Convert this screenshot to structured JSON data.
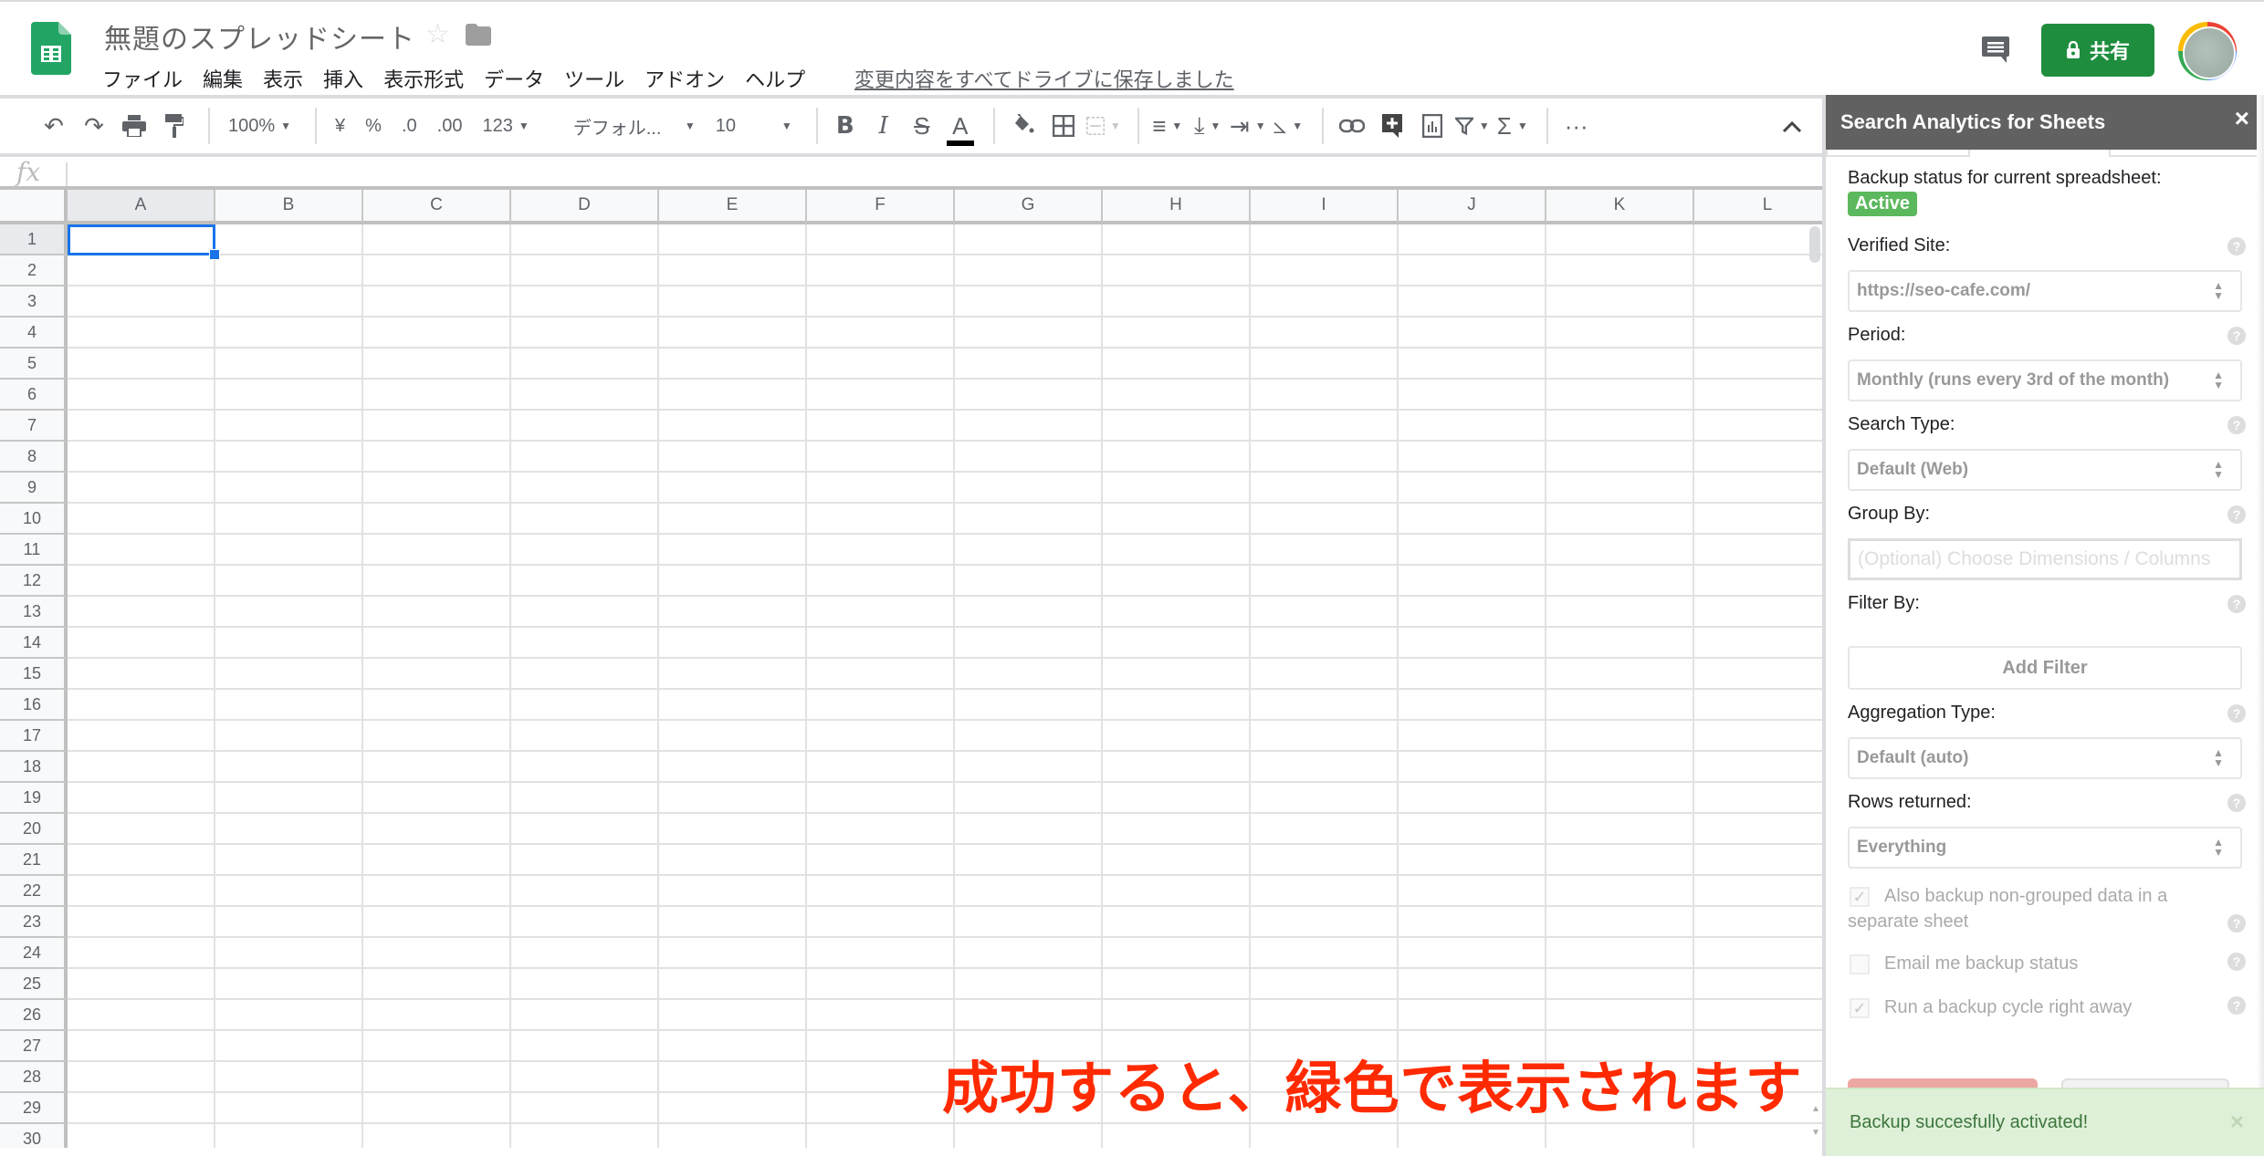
{
  "header": {
    "doc_title": "無題のスプレッドシート",
    "menu": [
      "ファイル",
      "編集",
      "表示",
      "挿入",
      "表示形式",
      "データ",
      "ツール",
      "アドオン",
      "ヘルプ"
    ],
    "save_status": "変更内容をすべてドライブに保存しました",
    "share_label": "共有",
    "icons": {
      "logo": "google-sheets-logo",
      "star": "star-icon",
      "folder": "folder-icon",
      "comment": "comment-icon",
      "lock": "lock-icon",
      "avatar": "user-avatar"
    }
  },
  "toolbar": {
    "zoom": "100%",
    "currency": "¥",
    "percent": "%",
    "decrease_decimal": ".0",
    "increase_decimal": ".00",
    "more_formats": "123",
    "font": "デフォル...",
    "font_size": "10",
    "bold": "B",
    "italic": "I",
    "strike": "S",
    "text_color": "A",
    "more": "···",
    "collapse": "^"
  },
  "formula_bar": {
    "fx_label": "fx",
    "value": ""
  },
  "grid": {
    "columns": [
      "A",
      "B",
      "C",
      "D",
      "E",
      "F",
      "G",
      "H",
      "I",
      "J",
      "K",
      "L"
    ],
    "rows": [
      "1",
      "2",
      "3",
      "4",
      "5",
      "6",
      "7",
      "8",
      "9",
      "10",
      "11",
      "12",
      "13",
      "14",
      "15",
      "16",
      "17",
      "18",
      "19",
      "20",
      "21",
      "22",
      "23",
      "24",
      "25",
      "26",
      "27",
      "28",
      "29",
      "30"
    ],
    "active_cell": "A1"
  },
  "annotation": "成功すると、緑色で表示されます",
  "sidebar": {
    "title": "Search Analytics for Sheets",
    "close": "×",
    "backup_status_label": "Backup status for current spreadsheet:",
    "backup_status": "Active",
    "fields": {
      "verified_site": {
        "label": "Verified Site:",
        "value": "https://seo-cafe.com/"
      },
      "period": {
        "label": "Period:",
        "value": "Monthly (runs every 3rd of the month)"
      },
      "search_type": {
        "label": "Search Type:",
        "value": "Default (Web)"
      },
      "group_by": {
        "label": "Group By:",
        "placeholder": "(Optional) Choose Dimensions / Columns"
      },
      "filter_by": {
        "label": "Filter By:",
        "button": "Add Filter"
      },
      "aggregation_type": {
        "label": "Aggregation Type:",
        "value": "Default (auto)"
      },
      "rows_returned": {
        "label": "Rows returned:",
        "value": "Everything"
      }
    },
    "checkboxes": [
      {
        "label": "Also backup non-grouped data in a separate sheet",
        "checked": true
      },
      {
        "label": "Email me backup status",
        "checked": false
      },
      {
        "label": "Run a backup cycle right away",
        "checked": true
      }
    ],
    "help_glyph": "?",
    "toast": {
      "message": "Backup succesfully activated!",
      "close": "×"
    }
  },
  "colors": {
    "share_green": "#1e8e3e",
    "active_badge": "#5cb85c",
    "selection_blue": "#1a73e8",
    "annotation_red": "#ff2a00",
    "toast_bg": "#dff0d8",
    "toast_text": "#3c763d",
    "sidebar_header": "#616161"
  }
}
